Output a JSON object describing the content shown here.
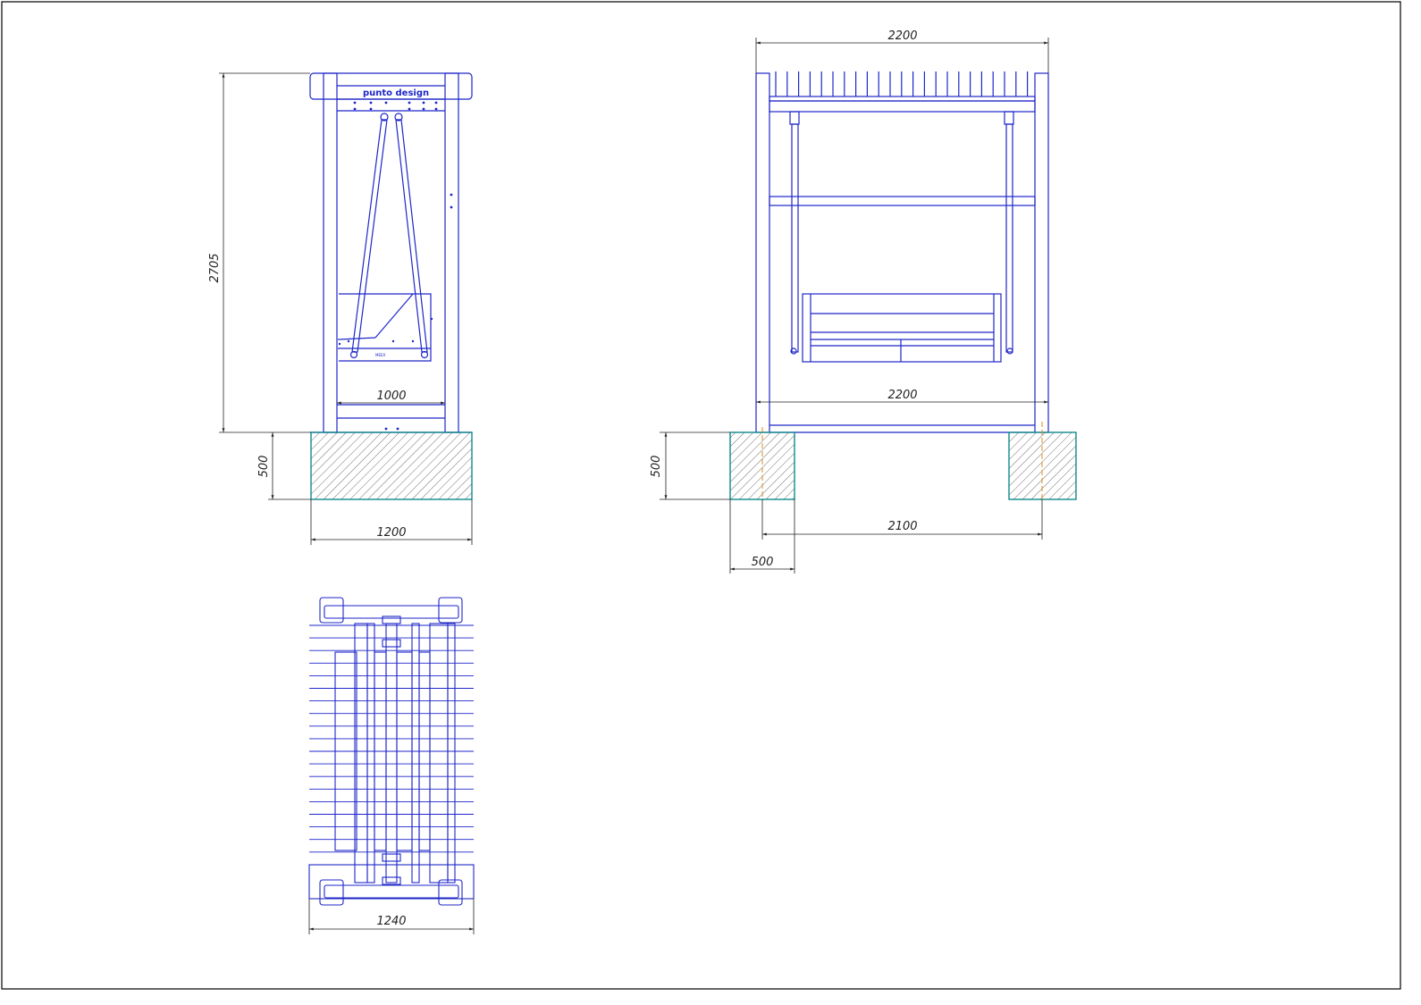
{
  "drawing": {
    "logo_text": "punto design",
    "small_label": "MEEX"
  },
  "dimensions": {
    "side_height": "2705",
    "side_inner_width": "1000",
    "side_base_height": "500",
    "side_base_width": "1200",
    "front_top_width": "2200",
    "front_inner_width": "2200",
    "front_base_height": "500",
    "front_footing_spacing": "2100",
    "front_footing_width": "500",
    "plan_width": "1240"
  },
  "colors": {
    "structure": "#1e26c8",
    "dimension": "#222222",
    "foundation_outline": "#0f8a8a",
    "hatch": "#333333",
    "anchor": "#e08a1e"
  }
}
